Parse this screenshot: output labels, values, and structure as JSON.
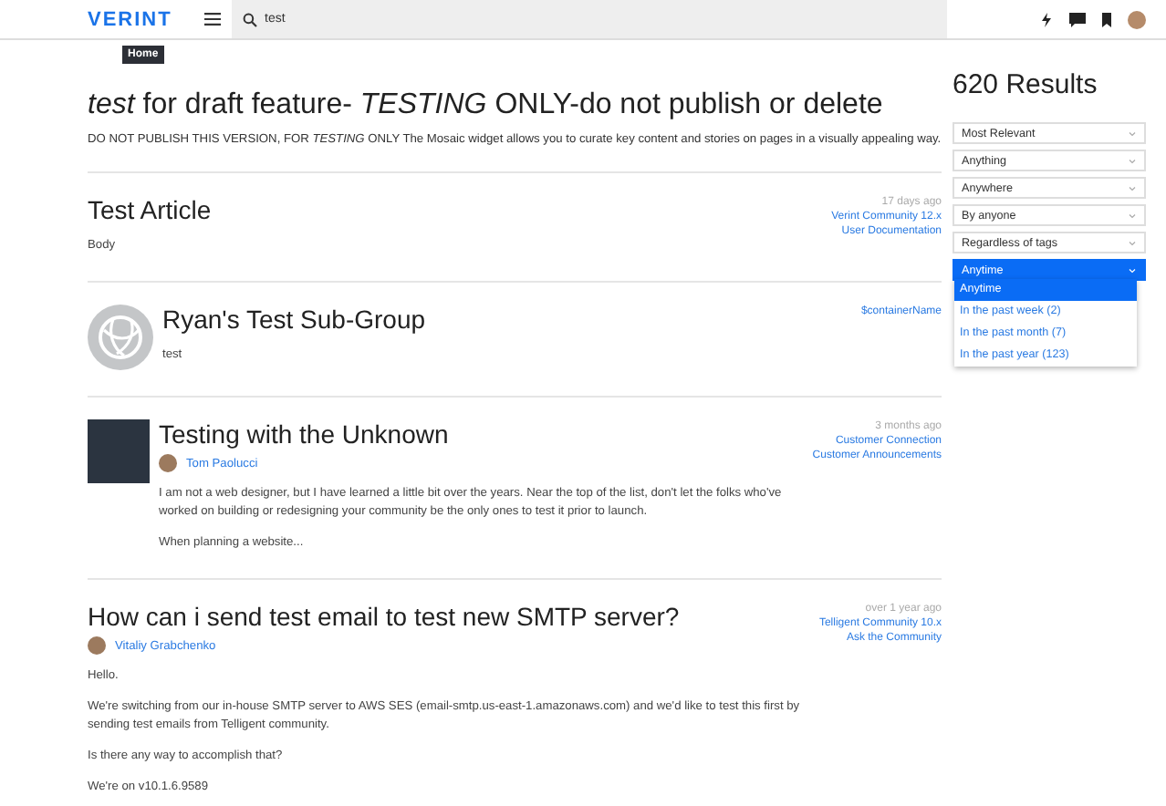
{
  "header": {
    "logo": "VERINT",
    "tooltip": "Home",
    "search": {
      "value": "test"
    }
  },
  "featured": {
    "title": "*test* for draft feature- *TESTING* ONLY-do not publish or delete",
    "description": "DO NOT PUBLISH THIS VERSION, FOR *TESTING* ONLY The Mosaic widget allows you to curate key content and stories on pages in a visually appealing way."
  },
  "results": [
    {
      "kind": "article",
      "title": "Test Article",
      "body": [
        "Body"
      ],
      "time": "17 days ago",
      "links": [
        "Verint Community 12.x",
        "User Documentation"
      ]
    },
    {
      "kind": "group",
      "title": "Ryan's Test Sub-Group",
      "body": [
        "test"
      ],
      "links": [
        "$containerName"
      ]
    },
    {
      "kind": "blog",
      "title": "Testing with the Unknown",
      "author": "Tom Paolucci",
      "body": [
        "I am not a web designer, but I have learned a little bit over the years. Near the top of the list, don't let the folks who've worked on building or redesigning your community be the only ones to test it prior to launch.",
        "When planning a website..."
      ],
      "time": "3 months ago",
      "links": [
        "Customer Connection",
        "Customer Announcements"
      ]
    },
    {
      "kind": "question",
      "title": "How can i send test email to test new SMTP server?",
      "author": "Vitaliy Grabchenko",
      "body": [
        "Hello.",
        "We're switching from our in-house SMTP server to AWS SES (email-smtp.us-east-1.amazonaws.com) and we'd like to test this first by sending test emails from Telligent community.",
        "Is there any way to accomplish that?",
        "We're on v10.1.6.9589"
      ],
      "time": "over 1 year ago",
      "links": [
        "Telligent Community 10.x",
        "Ask the Community"
      ]
    }
  ],
  "sidebar": {
    "heading": "620 Results",
    "filters": [
      {
        "label": "Most Relevant",
        "expanded": false
      },
      {
        "label": "Anything",
        "expanded": false
      },
      {
        "label": "Anywhere",
        "expanded": false
      },
      {
        "label": "By anyone",
        "expanded": false
      },
      {
        "label": "Regardless of tags",
        "expanded": false
      },
      {
        "label": "Anytime",
        "expanded": true,
        "options": [
          {
            "label": "Anytime",
            "selected": true
          },
          {
            "label": "In the past week (2)",
            "selected": false
          },
          {
            "label": "In the past month (7)",
            "selected": false
          },
          {
            "label": "In the past year (123)",
            "selected": false
          }
        ]
      }
    ]
  }
}
